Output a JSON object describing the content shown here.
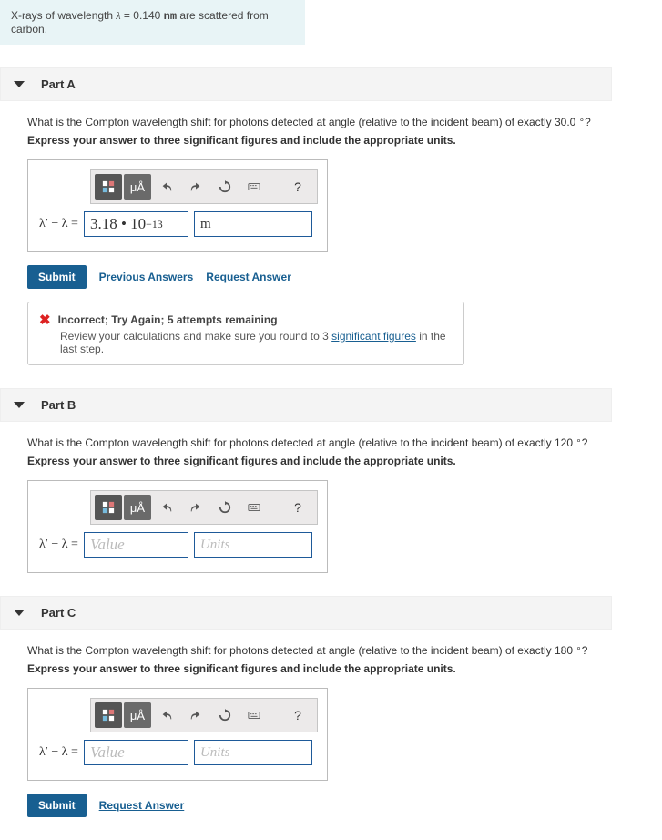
{
  "intro": {
    "prefix": "X-rays of wavelength ",
    "lambda": "λ",
    "eq": " = 0.140 ",
    "unit": "nm",
    "suffix": " are scattered from carbon."
  },
  "toolbar": {
    "mu_a": "μÅ",
    "help": "?"
  },
  "eqLabelA": "λ′ − λ = ",
  "partA": {
    "title": "Part A",
    "question_prefix": "What is the Compton wavelength shift for photons detected at angle (relative to the incident beam) of exactly 30.0 ",
    "deg": "∘",
    "question_suffix": "?",
    "instruct": "Express your answer to three significant figures and include the appropriate units.",
    "value": "3.18 • 10",
    "exp": "−13",
    "unit": "m",
    "submit": "Submit",
    "prev": "Previous Answers",
    "req": "Request Answer",
    "fb_title": "Incorrect; Try Again; 5 attempts remaining",
    "fb_body_a": "Review your calculations and make sure you round to 3 ",
    "fb_link": "significant figures",
    "fb_body_b": " in the last step."
  },
  "partB": {
    "title": "Part B",
    "question_prefix": "What is the Compton wavelength shift for photons detected at angle (relative to the incident beam) of exactly 120 ",
    "instruct": "Express your answer to three significant figures and include the appropriate units.",
    "value_ph": "Value",
    "unit_ph": "Units"
  },
  "partC": {
    "title": "Part C",
    "question_prefix": "What is the Compton wavelength shift for photons detected at angle (relative to the incident beam) of exactly 180 ",
    "instruct": "Express your answer to three significant figures and include the appropriate units.",
    "value_ph": "Value",
    "unit_ph": "Units",
    "submit": "Submit",
    "req": "Request Answer"
  }
}
